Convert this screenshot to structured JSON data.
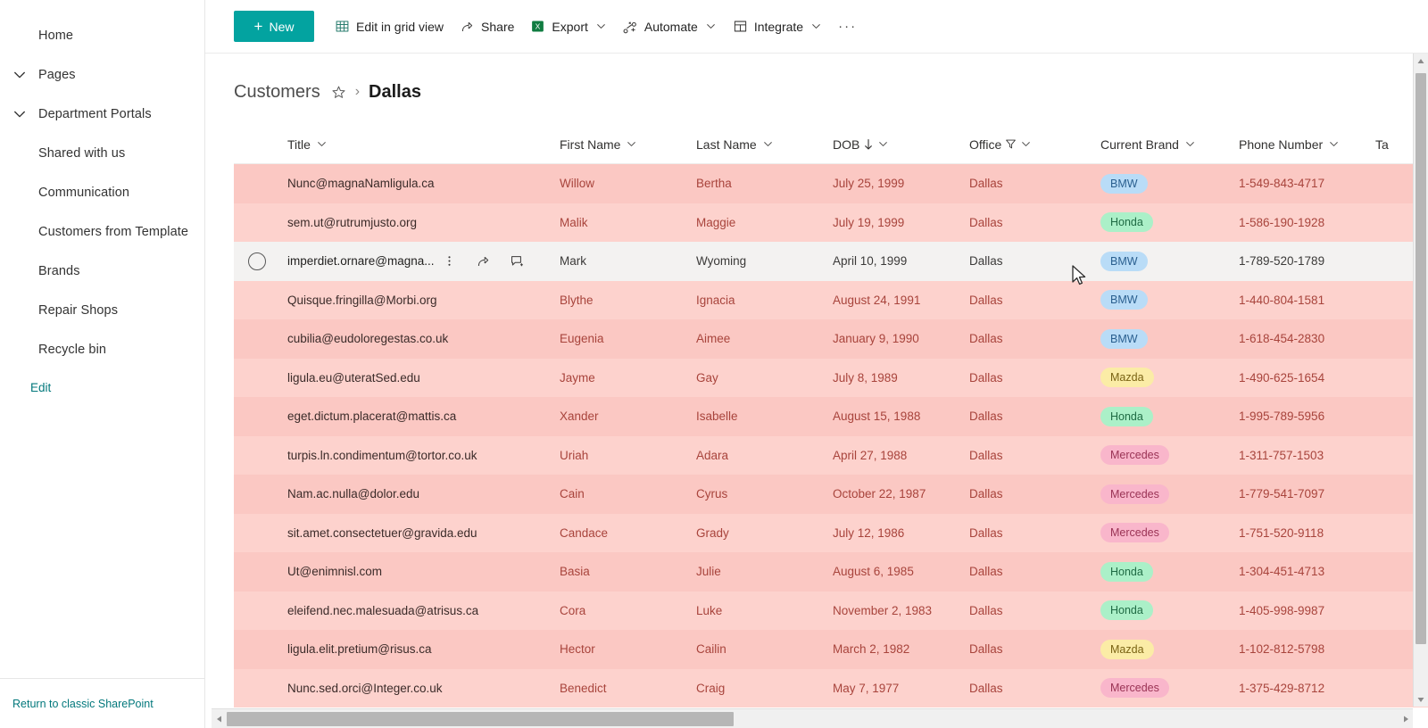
{
  "sidebar": {
    "items": [
      {
        "label": "Home",
        "expandable": false,
        "sub": false
      },
      {
        "label": "Pages",
        "expandable": true,
        "sub": false
      },
      {
        "label": "Department Portals",
        "expandable": true,
        "sub": false
      },
      {
        "label": "Shared with us",
        "expandable": false,
        "sub": true
      },
      {
        "label": "Communication",
        "expandable": false,
        "sub": true
      },
      {
        "label": "Customers from Template",
        "expandable": false,
        "sub": true
      },
      {
        "label": "Brands",
        "expandable": false,
        "sub": true
      },
      {
        "label": "Repair Shops",
        "expandable": false,
        "sub": true
      },
      {
        "label": "Recycle bin",
        "expandable": false,
        "sub": true
      }
    ],
    "edit_label": "Edit",
    "footer_label": "Return to classic SharePoint",
    "link_color": "#03787c"
  },
  "commandbar": {
    "new_label": "New",
    "new_plus": "+",
    "new_color": "#03a3a0",
    "items": [
      {
        "label": "Edit in grid view",
        "icon": "grid-icon",
        "caret": false
      },
      {
        "label": "Share",
        "icon": "share-icon",
        "caret": false
      },
      {
        "label": "Export",
        "icon": "excel-icon",
        "caret": true
      },
      {
        "label": "Automate",
        "icon": "automate-icon",
        "caret": true
      },
      {
        "label": "Integrate",
        "icon": "integrate-icon",
        "caret": true
      }
    ],
    "overflow_label": "···"
  },
  "breadcrumb": {
    "root": "Customers",
    "separator": "›",
    "current": "Dallas"
  },
  "table": {
    "columns": [
      {
        "label": "Title",
        "key": "title",
        "sort": "",
        "filter": false,
        "class": "c-title"
      },
      {
        "label": "First Name",
        "key": "first",
        "sort": "",
        "filter": false,
        "class": "c-first"
      },
      {
        "label": "Last Name",
        "key": "last",
        "sort": "",
        "filter": false,
        "class": "c-last"
      },
      {
        "label": "DOB",
        "key": "dob",
        "sort": "desc",
        "filter": false,
        "class": "c-dob"
      },
      {
        "label": "Office",
        "key": "office",
        "sort": "",
        "filter": true,
        "class": "c-office"
      },
      {
        "label": "Current Brand",
        "key": "brand",
        "sort": "",
        "filter": false,
        "class": "c-brand"
      },
      {
        "label": "Phone Number",
        "key": "phone",
        "sort": "",
        "filter": false,
        "class": "c-phone"
      },
      {
        "label": "Ta",
        "key": "tags",
        "sort": "",
        "filter": false,
        "class": "c-tags",
        "truncated": true
      }
    ],
    "hovered_row_index": 2,
    "row_actions": [
      "more-icon",
      "share-icon",
      "comment-icon"
    ],
    "brand_colors": {
      "BMW": "#b9dcf7",
      "Honda": "#abf0c8",
      "Mazda": "#fbeca6",
      "Mercedes": "#f9b6cb"
    },
    "row_tints": {
      "a": "#fbc8c3",
      "b": "#fdd2cd",
      "hover": "#f3f2f1"
    },
    "rows": [
      {
        "title": "Nunc@magnaNamligula.ca",
        "first": "Willow",
        "last": "Bertha",
        "dob": "July 25, 1999",
        "office": "Dallas",
        "brand": "BMW",
        "phone": "1-549-843-4717"
      },
      {
        "title": "sem.ut@rutrumjusto.org",
        "first": "Malik",
        "last": "Maggie",
        "dob": "July 19, 1999",
        "office": "Dallas",
        "brand": "Honda",
        "phone": "1-586-190-1928"
      },
      {
        "title": "imperdiet.ornare@magna...",
        "first": "Mark",
        "last": "Wyoming",
        "dob": "April 10, 1999",
        "office": "Dallas",
        "brand": "BMW",
        "phone": "1-789-520-1789"
      },
      {
        "title": "Quisque.fringilla@Morbi.org",
        "first": "Blythe",
        "last": "Ignacia",
        "dob": "August 24, 1991",
        "office": "Dallas",
        "brand": "BMW",
        "phone": "1-440-804-1581"
      },
      {
        "title": "cubilia@eudoloregestas.co.uk",
        "first": "Eugenia",
        "last": "Aimee",
        "dob": "January 9, 1990",
        "office": "Dallas",
        "brand": "BMW",
        "phone": "1-618-454-2830"
      },
      {
        "title": "ligula.eu@uteratSed.edu",
        "first": "Jayme",
        "last": "Gay",
        "dob": "July 8, 1989",
        "office": "Dallas",
        "brand": "Mazda",
        "phone": "1-490-625-1654"
      },
      {
        "title": "eget.dictum.placerat@mattis.ca",
        "first": "Xander",
        "last": "Isabelle",
        "dob": "August 15, 1988",
        "office": "Dallas",
        "brand": "Honda",
        "phone": "1-995-789-5956"
      },
      {
        "title": "turpis.ln.condimentum@tortor.co.uk",
        "first": "Uriah",
        "last": "Adara",
        "dob": "April 27, 1988",
        "office": "Dallas",
        "brand": "Mercedes",
        "phone": "1-311-757-1503"
      },
      {
        "title": "Nam.ac.nulla@dolor.edu",
        "first": "Cain",
        "last": "Cyrus",
        "dob": "October 22, 1987",
        "office": "Dallas",
        "brand": "Mercedes",
        "phone": "1-779-541-7097"
      },
      {
        "title": "sit.amet.consectetuer@gravida.edu",
        "first": "Candace",
        "last": "Grady",
        "dob": "July 12, 1986",
        "office": "Dallas",
        "brand": "Mercedes",
        "phone": "1-751-520-9118"
      },
      {
        "title": "Ut@enimnisl.com",
        "first": "Basia",
        "last": "Julie",
        "dob": "August 6, 1985",
        "office": "Dallas",
        "brand": "Honda",
        "phone": "1-304-451-4713"
      },
      {
        "title": "eleifend.nec.malesuada@atrisus.ca",
        "first": "Cora",
        "last": "Luke",
        "dob": "November 2, 1983",
        "office": "Dallas",
        "brand": "Honda",
        "phone": "1-405-998-9987"
      },
      {
        "title": "ligula.elit.pretium@risus.ca",
        "first": "Hector",
        "last": "Cailin",
        "dob": "March 2, 1982",
        "office": "Dallas",
        "brand": "Mazda",
        "phone": "1-102-812-5798"
      },
      {
        "title": "Nunc.sed.orci@Integer.co.uk",
        "first": "Benedict",
        "last": "Craig",
        "dob": "May 7, 1977",
        "office": "Dallas",
        "brand": "Mercedes",
        "phone": "1-375-429-8712"
      }
    ]
  }
}
